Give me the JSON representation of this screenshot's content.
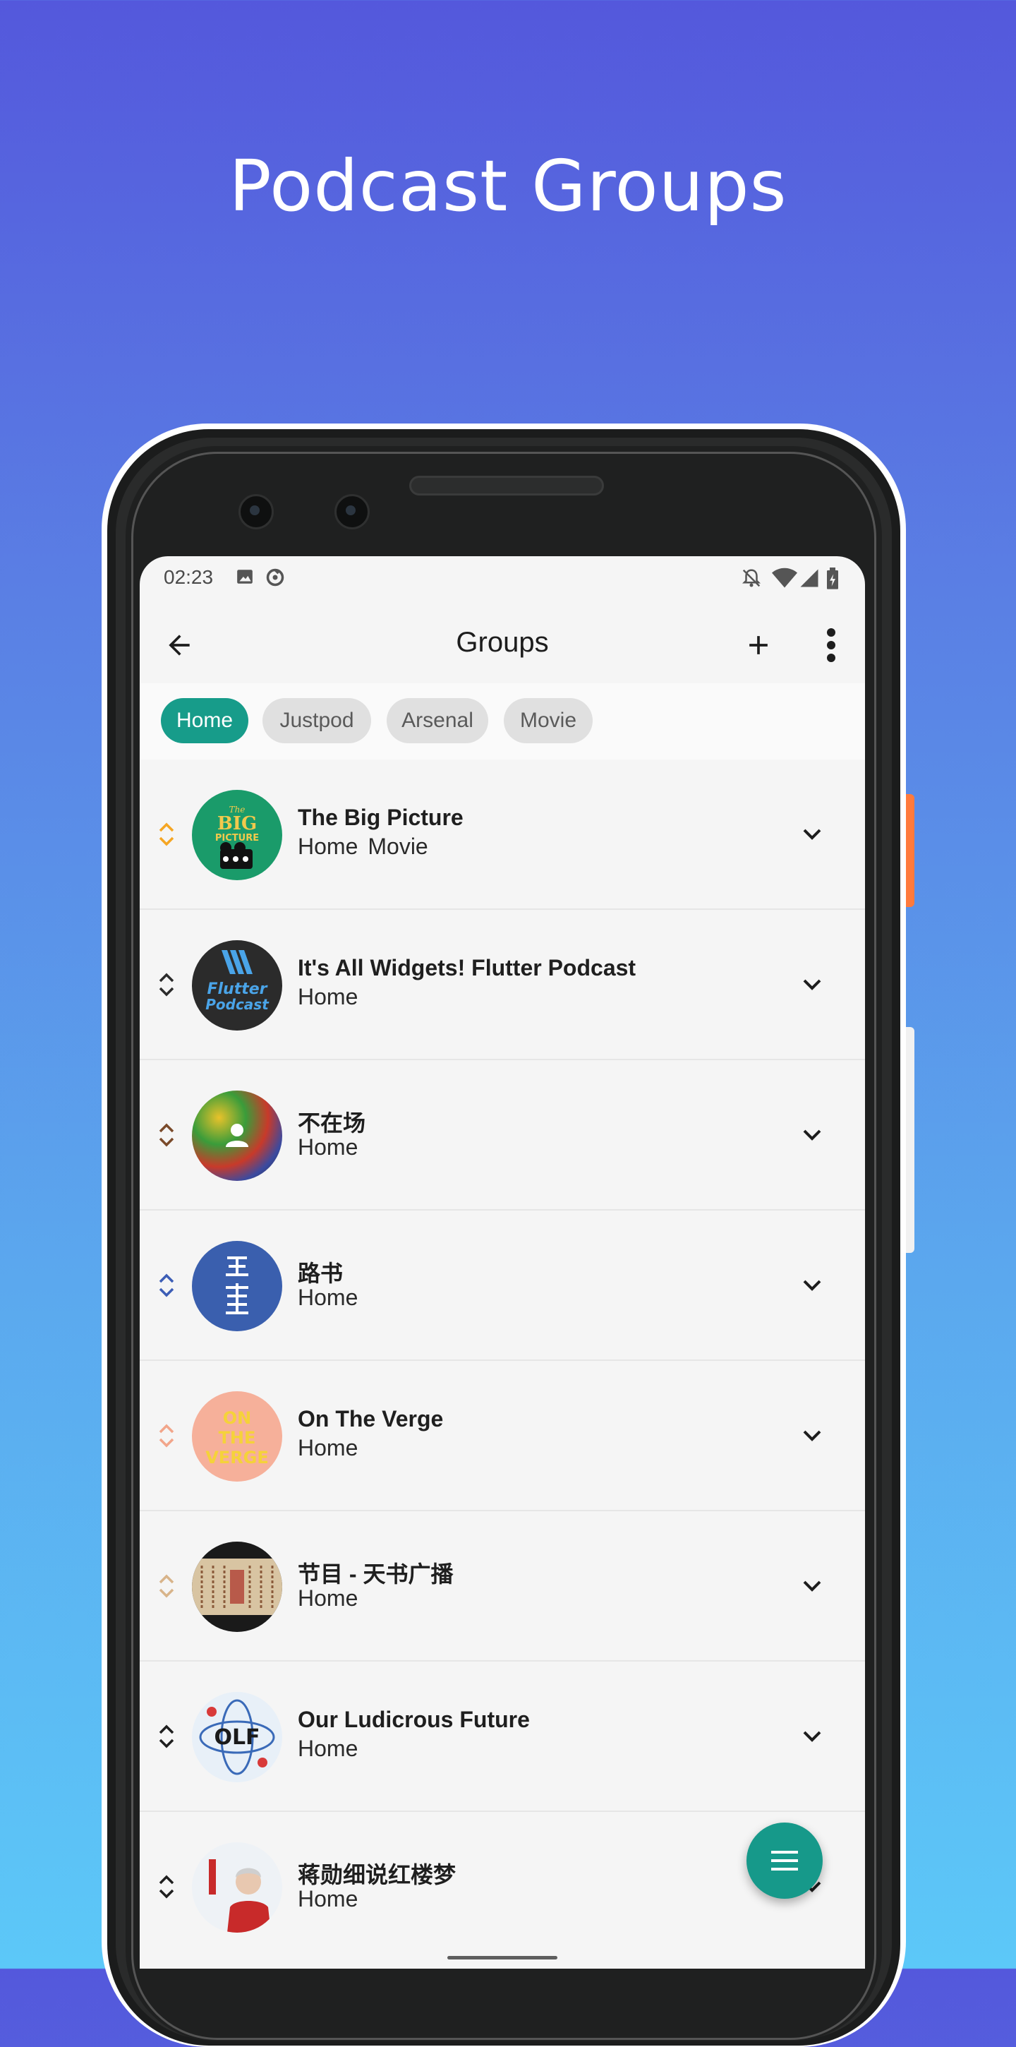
{
  "page": {
    "headline": "Podcast Groups"
  },
  "status_bar": {
    "time": "02:23"
  },
  "app_bar": {
    "title": "Groups"
  },
  "group_chips": [
    {
      "label": "Home",
      "selected": true
    },
    {
      "label": "Justpod",
      "selected": false
    },
    {
      "label": "Arsenal",
      "selected": false
    },
    {
      "label": "Movie",
      "selected": false
    }
  ],
  "podcasts": [
    {
      "title": "The Big Picture",
      "groups": [
        "Home",
        "Movie"
      ],
      "reorder_color": "#f5a623"
    },
    {
      "title": "It's All Widgets! Flutter Podcast",
      "groups": [
        "Home"
      ],
      "reorder_color": "#2b2b2b"
    },
    {
      "title": "不在场",
      "groups": [
        "Home"
      ],
      "reorder_color": "#7a4a2a"
    },
    {
      "title": "路书",
      "groups": [
        "Home"
      ],
      "reorder_color": "#3c5db5"
    },
    {
      "title": "On The Verge",
      "groups": [
        "Home"
      ],
      "reorder_color": "#f2a58a"
    },
    {
      "title": "节目 - 天书广播",
      "groups": [
        "Home"
      ],
      "reorder_color": "#d8b48a"
    },
    {
      "title": "Our Ludicrous Future",
      "groups": [
        "Home"
      ],
      "reorder_color": "#1f1f1f"
    },
    {
      "title": "蒋勋细说红楼梦",
      "groups": [
        "Home"
      ],
      "reorder_color": "#1f1f1f"
    }
  ],
  "colors": {
    "accent": "#179c8a",
    "fab": "#16998a"
  },
  "icons": [
    "back-arrow-icon",
    "add-icon",
    "more-vert-icon",
    "chevron-down-icon",
    "reorder-icon",
    "menu-icon"
  ]
}
